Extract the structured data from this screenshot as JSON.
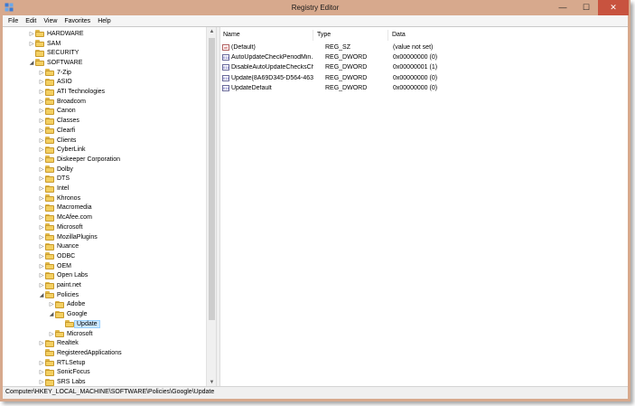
{
  "window": {
    "title": "Registry Editor",
    "minimize": "—",
    "maximize": "☐",
    "close": "✕"
  },
  "menu": [
    "File",
    "Edit",
    "View",
    "Favorites",
    "Help"
  ],
  "tree": [
    {
      "label": "HARDWARE",
      "depth": 1,
      "expander": "▷"
    },
    {
      "label": "SAM",
      "depth": 1,
      "expander": "▷"
    },
    {
      "label": "SECURITY",
      "depth": 1,
      "expander": ""
    },
    {
      "label": "SOFTWARE",
      "depth": 1,
      "expander": "◢"
    },
    {
      "label": "7-Zip",
      "depth": 2,
      "expander": "▷"
    },
    {
      "label": "ASIO",
      "depth": 2,
      "expander": "▷"
    },
    {
      "label": "ATI Technologies",
      "depth": 2,
      "expander": "▷"
    },
    {
      "label": "Broadcom",
      "depth": 2,
      "expander": "▷"
    },
    {
      "label": "Canon",
      "depth": 2,
      "expander": "▷"
    },
    {
      "label": "Classes",
      "depth": 2,
      "expander": "▷"
    },
    {
      "label": "Clearfi",
      "depth": 2,
      "expander": "▷"
    },
    {
      "label": "Clients",
      "depth": 2,
      "expander": "▷"
    },
    {
      "label": "CyberLink",
      "depth": 2,
      "expander": "▷"
    },
    {
      "label": "Diskeeper Corporation",
      "depth": 2,
      "expander": "▷"
    },
    {
      "label": "Dolby",
      "depth": 2,
      "expander": "▷"
    },
    {
      "label": "DTS",
      "depth": 2,
      "expander": "▷"
    },
    {
      "label": "Intel",
      "depth": 2,
      "expander": "▷"
    },
    {
      "label": "Khronos",
      "depth": 2,
      "expander": "▷"
    },
    {
      "label": "Macromedia",
      "depth": 2,
      "expander": "▷"
    },
    {
      "label": "McAfee.com",
      "depth": 2,
      "expander": "▷"
    },
    {
      "label": "Microsoft",
      "depth": 2,
      "expander": "▷"
    },
    {
      "label": "MozillaPlugins",
      "depth": 2,
      "expander": "▷"
    },
    {
      "label": "Nuance",
      "depth": 2,
      "expander": "▷"
    },
    {
      "label": "ODBC",
      "depth": 2,
      "expander": "▷"
    },
    {
      "label": "OEM",
      "depth": 2,
      "expander": "▷"
    },
    {
      "label": "Open Labs",
      "depth": 2,
      "expander": "▷"
    },
    {
      "label": "paint.net",
      "depth": 2,
      "expander": "▷"
    },
    {
      "label": "Policies",
      "depth": 2,
      "expander": "◢"
    },
    {
      "label": "Adobe",
      "depth": 3,
      "expander": "▷"
    },
    {
      "label": "Google",
      "depth": 3,
      "expander": "◢"
    },
    {
      "label": "Update",
      "depth": 4,
      "expander": "",
      "selected": true
    },
    {
      "label": "Microsoft",
      "depth": 3,
      "expander": "▷"
    },
    {
      "label": "Realtek",
      "depth": 2,
      "expander": "▷"
    },
    {
      "label": "RegisteredApplications",
      "depth": 2,
      "expander": ""
    },
    {
      "label": "RTLSetup",
      "depth": 2,
      "expander": "▷"
    },
    {
      "label": "SonicFocus",
      "depth": 2,
      "expander": "▷"
    },
    {
      "label": "SRS Labs",
      "depth": 2,
      "expander": "▷"
    }
  ],
  "list": {
    "headers": {
      "name": "Name",
      "type": "Type",
      "data": "Data"
    },
    "rows": [
      {
        "name": "(Default)",
        "type": "REG_SZ",
        "data": "(value not set)",
        "kind": "sz"
      },
      {
        "name": "AutoUpdateCheckPeriodMin...",
        "type": "REG_DWORD",
        "data": "0x00000000 (0)",
        "kind": "dword"
      },
      {
        "name": "DisableAutoUpdateChecksCh...",
        "type": "REG_DWORD",
        "data": "0x00000001 (1)",
        "kind": "dword"
      },
      {
        "name": "Update{8A69D345-D564-463C...",
        "type": "REG_DWORD",
        "data": "0x00000000 (0)",
        "kind": "dword"
      },
      {
        "name": "UpdateDefault",
        "type": "REG_DWORD",
        "data": "0x00000000 (0)",
        "kind": "dword"
      }
    ]
  },
  "status": "Computer\\HKEY_LOCAL_MACHINE\\SOFTWARE\\Policies\\Google\\Update",
  "icons": {
    "sz": "ab",
    "dword": "011"
  }
}
